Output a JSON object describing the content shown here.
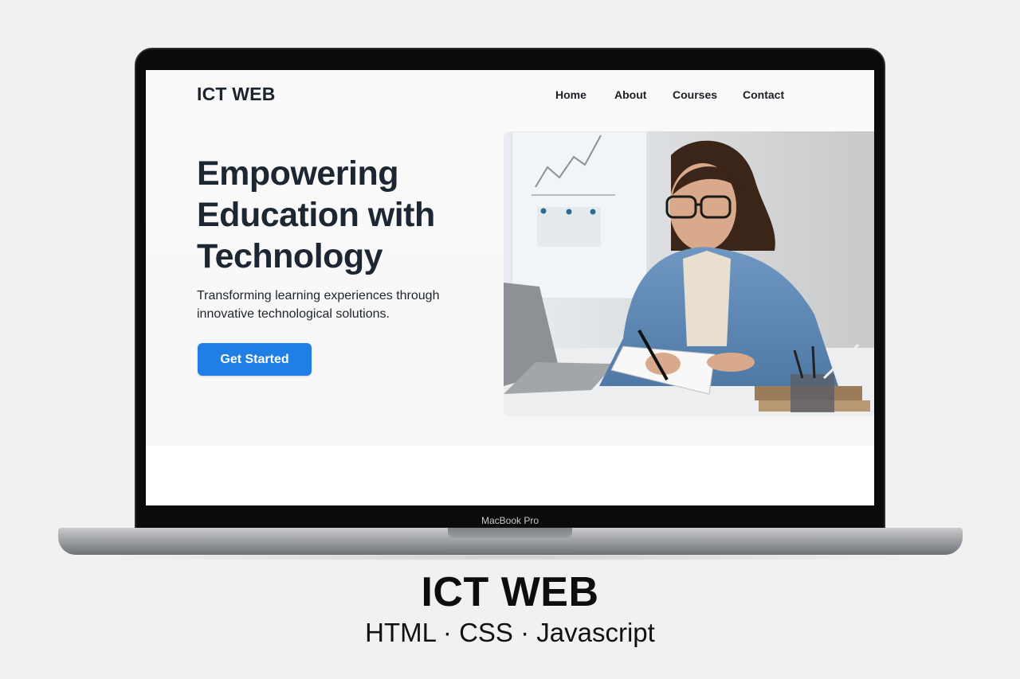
{
  "site": {
    "logo": "ICT WEB",
    "nav": [
      "Home",
      "About",
      "Courses",
      "Contact"
    ]
  },
  "hero": {
    "headline": "Empowering Education with Technology",
    "subtext": "Transforming learning experiences through innovative technological solutions.",
    "cta_label": "Get Started",
    "image_alt": "student-writing-at-desk"
  },
  "device": {
    "model_label": "MacBook Pro"
  },
  "caption": {
    "title": "ICT WEB",
    "subtitle": "HTML · CSS · Javascript"
  },
  "colors": {
    "accent": "#1f7fe4",
    "heading": "#1d2733",
    "page_bg": "#f1f1f1"
  }
}
